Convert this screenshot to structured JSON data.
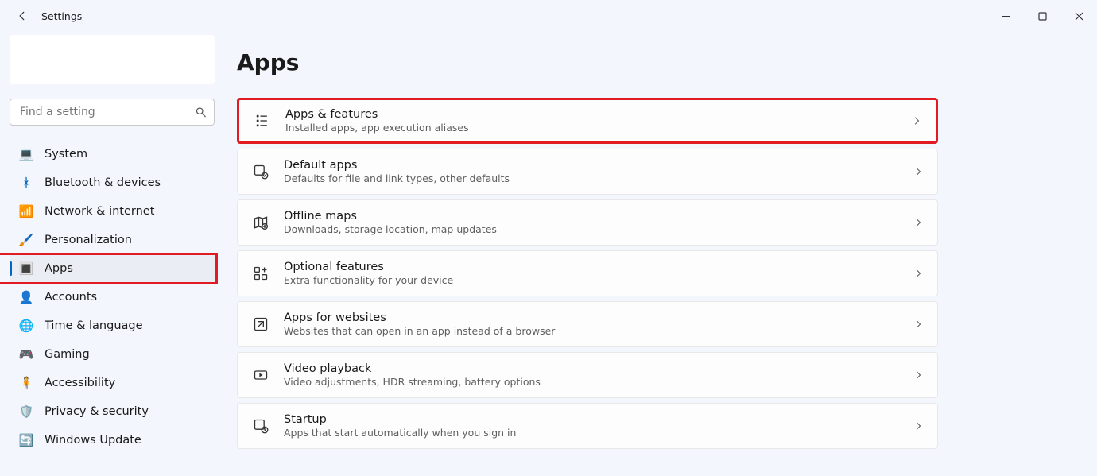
{
  "window": {
    "title": "Settings"
  },
  "search": {
    "placeholder": "Find a setting"
  },
  "page": {
    "title": "Apps"
  },
  "sidebar": {
    "items": [
      {
        "label": "System",
        "icon": "💻"
      },
      {
        "label": "Bluetooth & devices",
        "icon": "ᚼ"
      },
      {
        "label": "Network & internet",
        "icon": "📶"
      },
      {
        "label": "Personalization",
        "icon": "🖌️"
      },
      {
        "label": "Apps",
        "icon": "🔳"
      },
      {
        "label": "Accounts",
        "icon": "👤"
      },
      {
        "label": "Time & language",
        "icon": "🌐"
      },
      {
        "label": "Gaming",
        "icon": "🎮"
      },
      {
        "label": "Accessibility",
        "icon": "🧍"
      },
      {
        "label": "Privacy & security",
        "icon": "🛡️"
      },
      {
        "label": "Windows Update",
        "icon": "🔄"
      }
    ],
    "active_index": 4
  },
  "cards": [
    {
      "title": "Apps & features",
      "subtitle": "Installed apps, app execution aliases"
    },
    {
      "title": "Default apps",
      "subtitle": "Defaults for file and link types, other defaults"
    },
    {
      "title": "Offline maps",
      "subtitle": "Downloads, storage location, map updates"
    },
    {
      "title": "Optional features",
      "subtitle": "Extra functionality for your device"
    },
    {
      "title": "Apps for websites",
      "subtitle": "Websites that can open in an app instead of a browser"
    },
    {
      "title": "Video playback",
      "subtitle": "Video adjustments, HDR streaming, battery options"
    },
    {
      "title": "Startup",
      "subtitle": "Apps that start automatically when you sign in"
    }
  ],
  "highlight_card_index": 0
}
